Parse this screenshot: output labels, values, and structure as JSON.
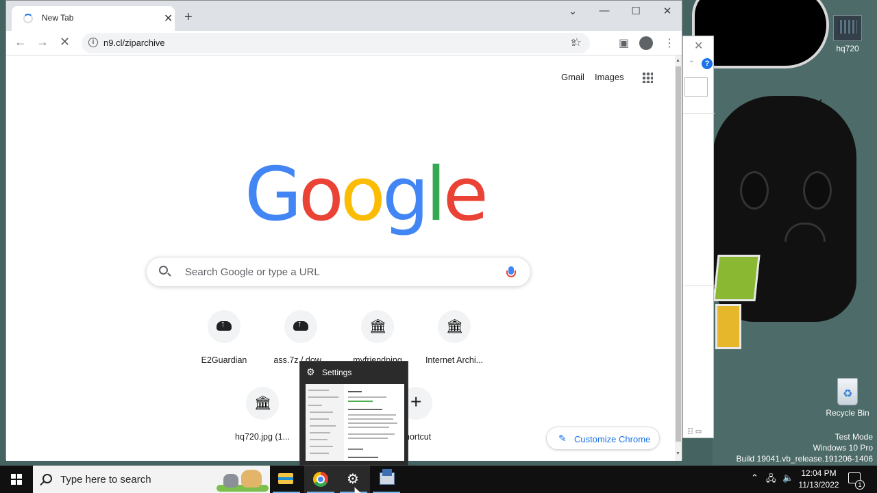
{
  "desktop": {
    "icons": [
      {
        "label": "hq720"
      },
      {
        "label": "Recycle Bin"
      }
    ],
    "watermark": {
      "line1": "Test Mode",
      "line2": "Windows 10 Pro",
      "line3": "Build 19041.vb_release.191206-1406"
    }
  },
  "background_window": {
    "help_label": "?"
  },
  "browser": {
    "tab": {
      "title": "New Tab"
    },
    "address": {
      "url": "n9.cl/ziparchive"
    },
    "top_links": {
      "gmail": "Gmail",
      "images": "Images"
    },
    "logo": [
      "G",
      "o",
      "o",
      "g",
      "l",
      "e"
    ],
    "search": {
      "placeholder": "Search Google or type a URL"
    },
    "shortcuts": [
      {
        "label": "E2Guardian",
        "icon": "cloud-upload-icon"
      },
      {
        "label": "ass.7z / dow...",
        "icon": "cloud-upload-icon"
      },
      {
        "label": "myfriendping",
        "icon": "museum-icon"
      },
      {
        "label": "Internet Archi...",
        "icon": "museum-icon"
      },
      {
        "label": "hq720.jpg (1...",
        "icon": "museum-icon"
      },
      {
        "label": "shortcut",
        "icon": "plus-icon"
      }
    ],
    "customize": {
      "label": "Customize Chrome"
    }
  },
  "thumbnail": {
    "title": "Settings"
  },
  "taskbar": {
    "search_placeholder": "Type here to search",
    "clock": {
      "time": "12:04 PM",
      "date": "11/13/2022"
    },
    "notification_count": "1"
  }
}
